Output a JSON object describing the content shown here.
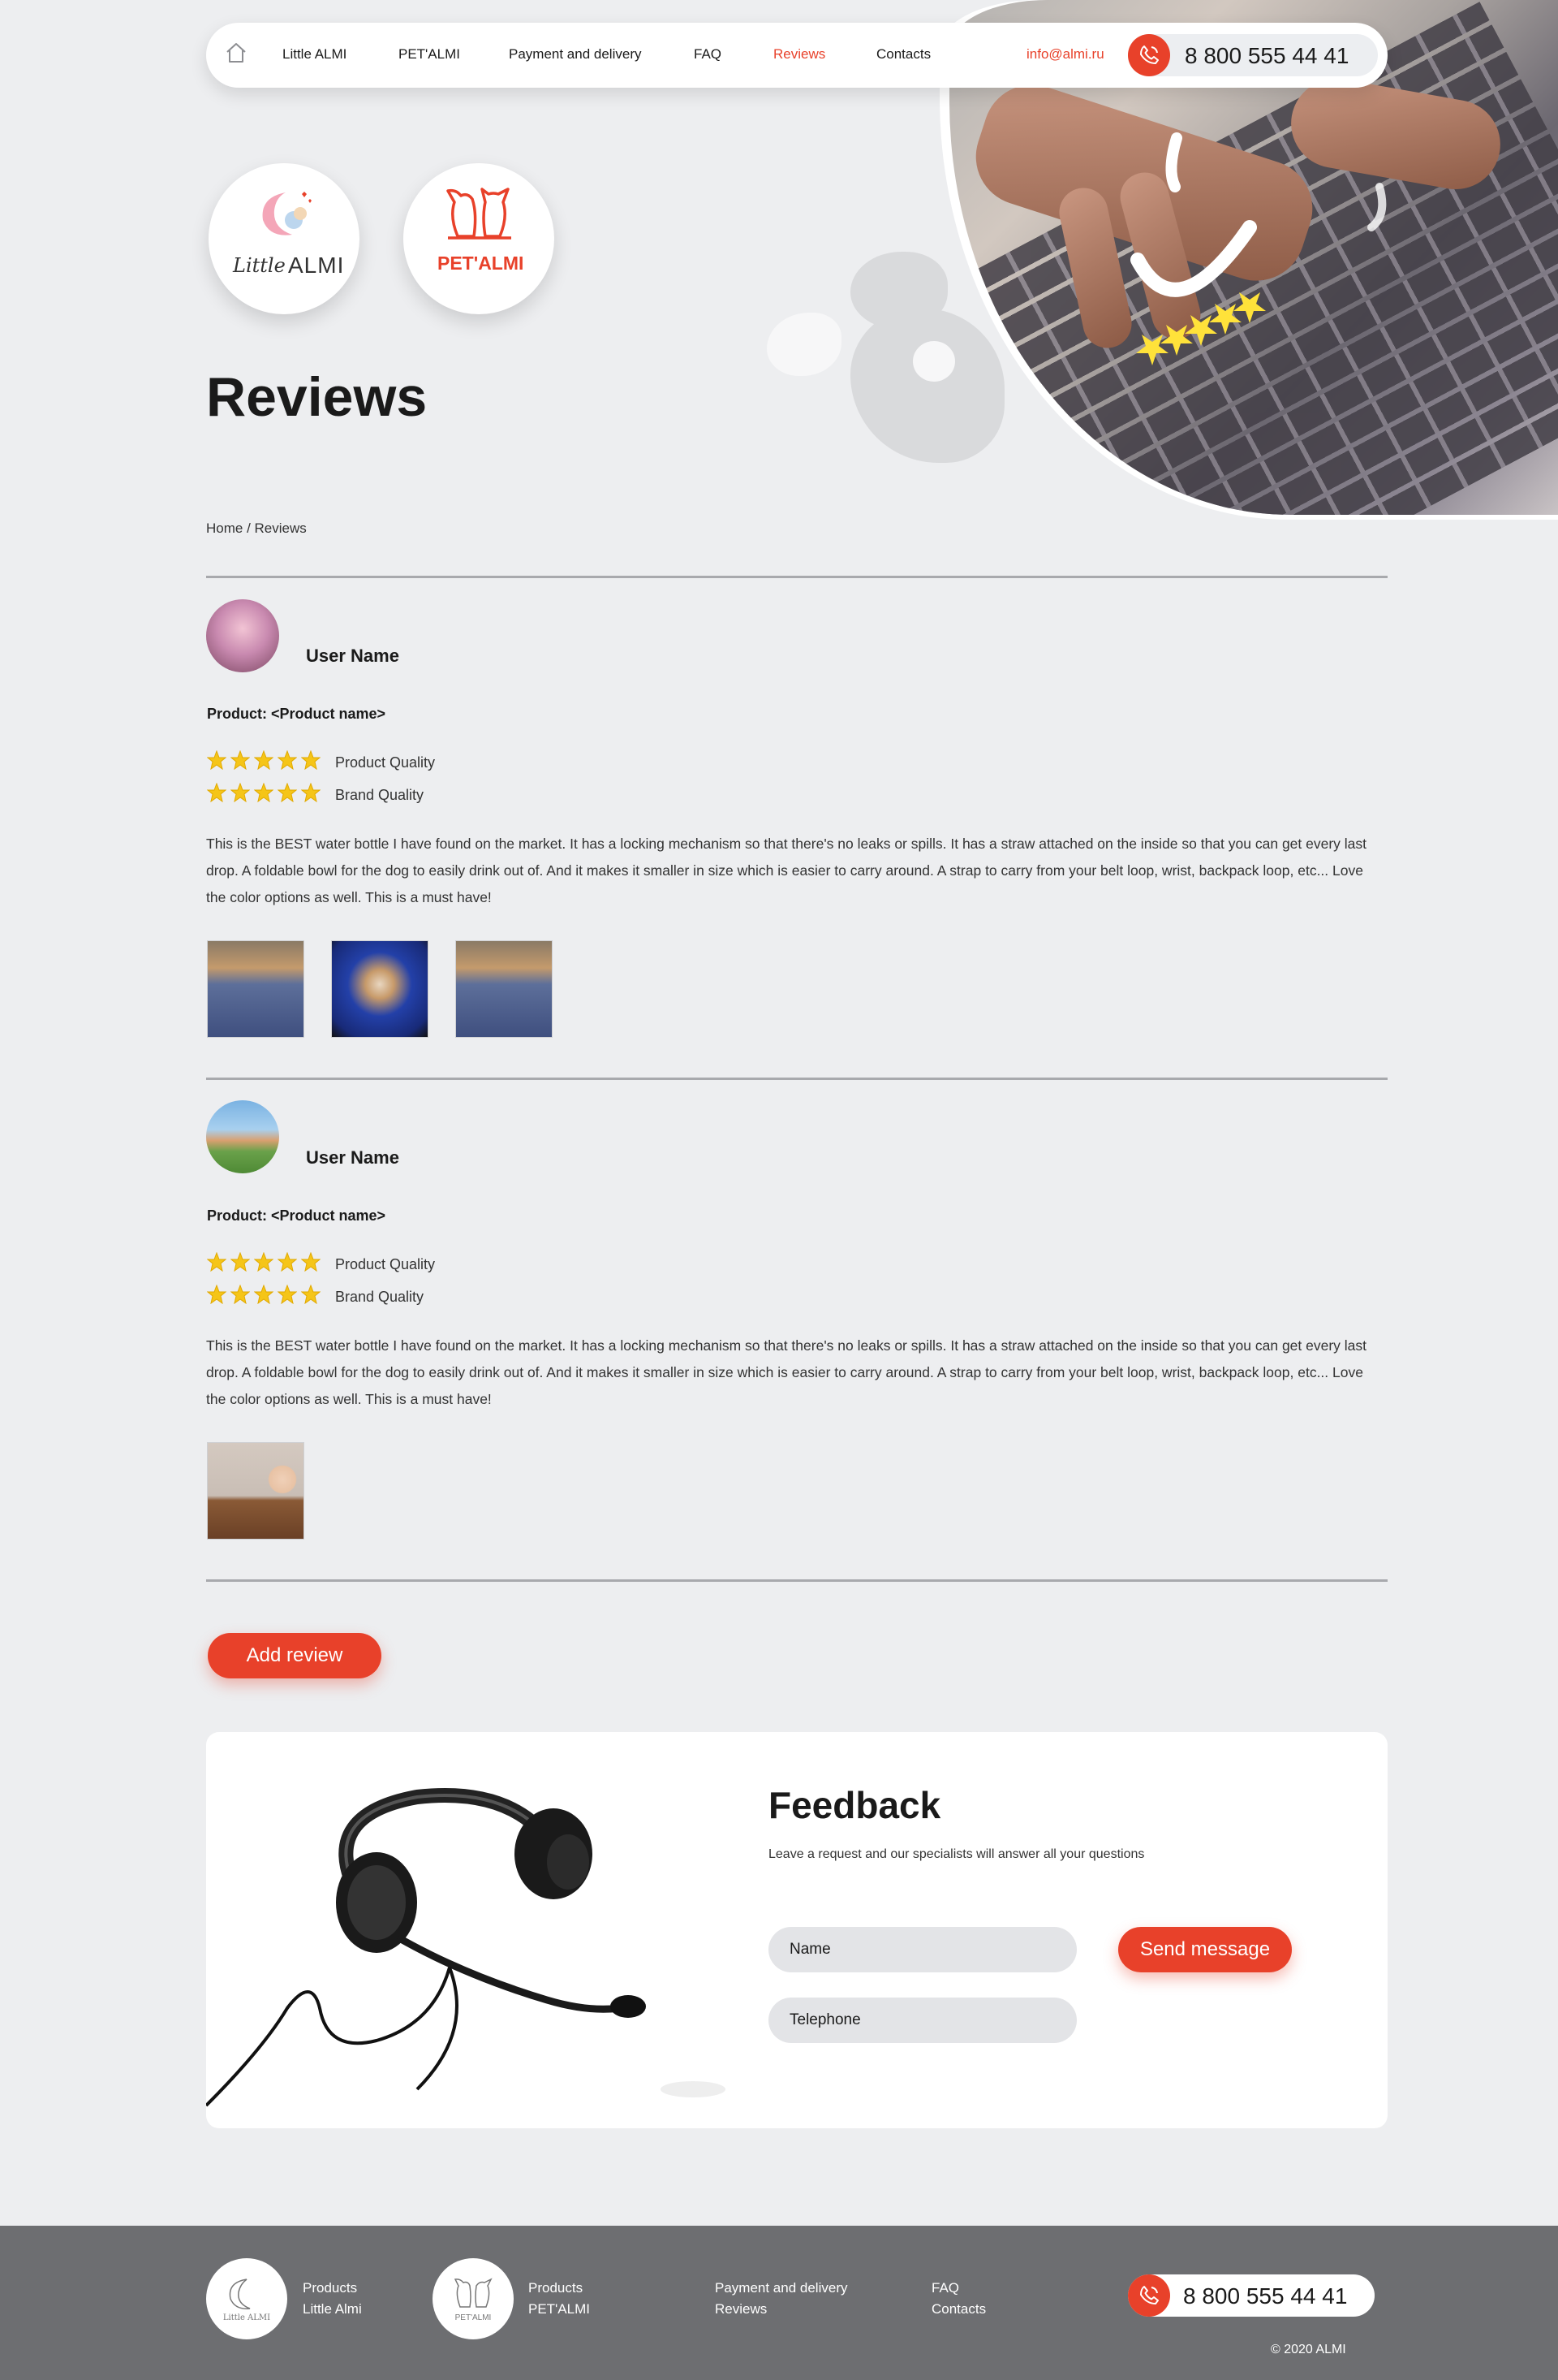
{
  "nav": {
    "items": [
      "Little ALMI",
      "PET'ALMI",
      "Payment and delivery",
      "FAQ",
      "Reviews",
      "Contacts"
    ],
    "active": "Reviews",
    "email": "info@almi.ru",
    "phone": "8 800 555 44 41"
  },
  "brands": {
    "little": {
      "script": "Little",
      "caps": "ALMI"
    },
    "pet": "PET'ALMI"
  },
  "page": {
    "title": "Reviews",
    "breadcrumb": "Home / Reviews"
  },
  "reviews": [
    {
      "user": "User Name",
      "product": "Product: <Product name>",
      "ratings": [
        {
          "label": "Product Quality",
          "stars": 5
        },
        {
          "label": "Brand Quality",
          "stars": 5
        }
      ],
      "text": "This is the BEST water bottle I have found on the market. It has a locking mechanism so that there's no leaks or spills. It has a straw attached on the inside so that you can get every last drop. A foldable bowl for the dog to easily drink out of. And it makes it smaller in size which is easier to carry around. A strap to carry from your belt loop, wrist, backpack loop, etc... Love the color options as well. This is a must have!",
      "photos": [
        "dogs-in-car-photo",
        "dog-on-seat-photo",
        "dogs-in-car-photo"
      ]
    },
    {
      "user": "User Name",
      "product": "Product: <Product name>",
      "ratings": [
        {
          "label": "Product Quality",
          "stars": 5
        },
        {
          "label": "Brand Quality",
          "stars": 5
        }
      ],
      "text": "This is the BEST water bottle I have found on the market. It has a locking mechanism so that there's no leaks or spills. It has a straw attached on the inside so that you can get every last drop. A foldable bowl for the dog to easily drink out of. And it makes it smaller in size which is easier to carry around. A strap to carry from your belt loop, wrist, backpack loop, etc... Love the color options as well. This is a must have!",
      "photos": [
        "child-with-blocks-photo"
      ]
    }
  ],
  "add_review_label": "Add review",
  "feedback": {
    "title": "Feedback",
    "subtitle": "Leave a request and our specialists will answer all your questions",
    "name_placeholder": "Name",
    "phone_placeholder": "Telephone",
    "send_label": "Send message"
  },
  "footer": {
    "col1": [
      "Products",
      "Little Almi"
    ],
    "col2": [
      "Products",
      "PET'ALMI"
    ],
    "col3": [
      "Payment and delivery",
      "Reviews"
    ],
    "col4": [
      "FAQ",
      "Contacts"
    ],
    "phone": "8 800 555 44 41",
    "copyright": "© 2020 ALMI",
    "logo_little": "Little ALMI",
    "logo_pet": "PET'ALMI"
  },
  "colors": {
    "accent": "#e8412a",
    "background": "#edeef0",
    "footer": "#6d6e71",
    "star": "#f5c518"
  }
}
